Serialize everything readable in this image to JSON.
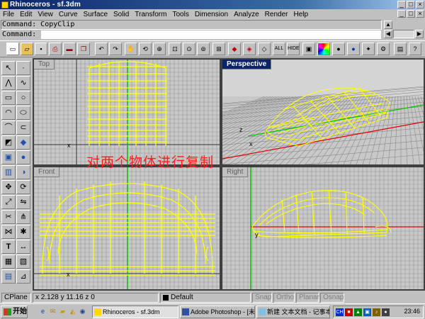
{
  "window": {
    "title": "Rhinoceros - sf.3dm"
  },
  "menu": [
    "File",
    "Edit",
    "View",
    "Curve",
    "Surface",
    "Solid",
    "Transform",
    "Tools",
    "Dimension",
    "Analyze",
    "Render",
    "Help"
  ],
  "command": {
    "history": "Command: CopyClip",
    "prompt": "Command:",
    "value": ""
  },
  "viewports": {
    "top": "Top",
    "perspective": "Perspective",
    "front": "Front",
    "right": "Right"
  },
  "axis_labels": {
    "x": "x",
    "y": "y",
    "z": "z"
  },
  "annotation": "对两个物体进行复制",
  "status": {
    "cplane": "CPlane",
    "coords": "x 2.128  y 11.16  z 0",
    "layer": "Default",
    "snap": "Snap",
    "ortho": "Ortho",
    "planar": "Planar",
    "osnap": "Osnap"
  },
  "taskbar": {
    "start": "开始",
    "tasks": [
      "Rhinoceros - sf.3dm",
      "Adobe Photoshop - [未...",
      "新建 文本文档 - 记事本"
    ],
    "clock": "23:46",
    "tray_text": "CH"
  },
  "colors": {
    "curve": "#ffff00",
    "grid": "#9a9a9a",
    "grid_major": "#6a6a6a",
    "viewport_bg": "#c8c8c8",
    "active_title": "#0a246a",
    "annotation": "#ff2020"
  }
}
